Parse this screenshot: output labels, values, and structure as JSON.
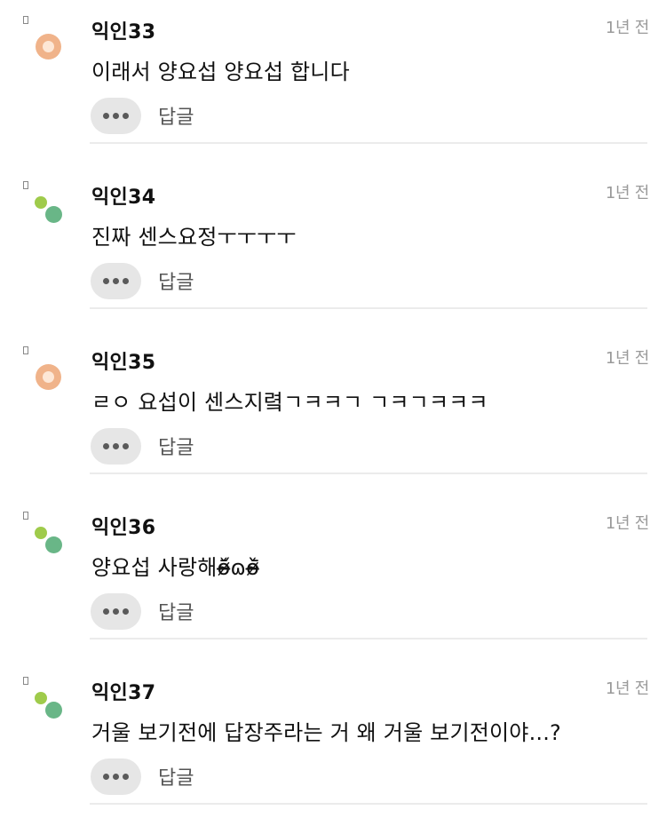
{
  "comments": [
    {
      "username": "익인33",
      "time": "1년 전",
      "text": "이래서 양요섭 양요섭 합니다",
      "avatar": "orange",
      "reply_label": "답글",
      "more_icon": "more-dots-icon"
    },
    {
      "username": "익인34",
      "time": "1년 전",
      "text": "진짜 센스요정ㅜㅜㅜㅜ",
      "avatar": "green",
      "reply_label": "답글",
      "more_icon": "more-dots-icon"
    },
    {
      "username": "익인35",
      "time": "1년 전",
      "text": "ㄹㅇ 요섭이 센스지렼ㄱㅋㅋㄱ ㄱㅋㄱㅋㅋㅋ",
      "avatar": "orange",
      "reply_label": "답글",
      "more_icon": "more-dots-icon"
    },
    {
      "username": "익인36",
      "time": "1년 전",
      "text": "양요섭 사랑해ǒ̴̶̷᷄ɷǒ̴̶̷᷅",
      "avatar": "green",
      "reply_label": "답글",
      "more_icon": "more-dots-icon"
    },
    {
      "username": "익인37",
      "time": "1년 전",
      "text": "거울 보기전에 답장주라는 거 왜 거울 보기전이야...?",
      "avatar": "green",
      "reply_label": "답글",
      "more_icon": "more-dots-icon"
    }
  ],
  "colors": {
    "avatar_orange": "#f0b38a",
    "avatar_green_light": "#9fcb4b",
    "avatar_green_dark": "#69b687",
    "time_gray": "#9a9a9a",
    "button_bg": "#e6e6e6"
  }
}
